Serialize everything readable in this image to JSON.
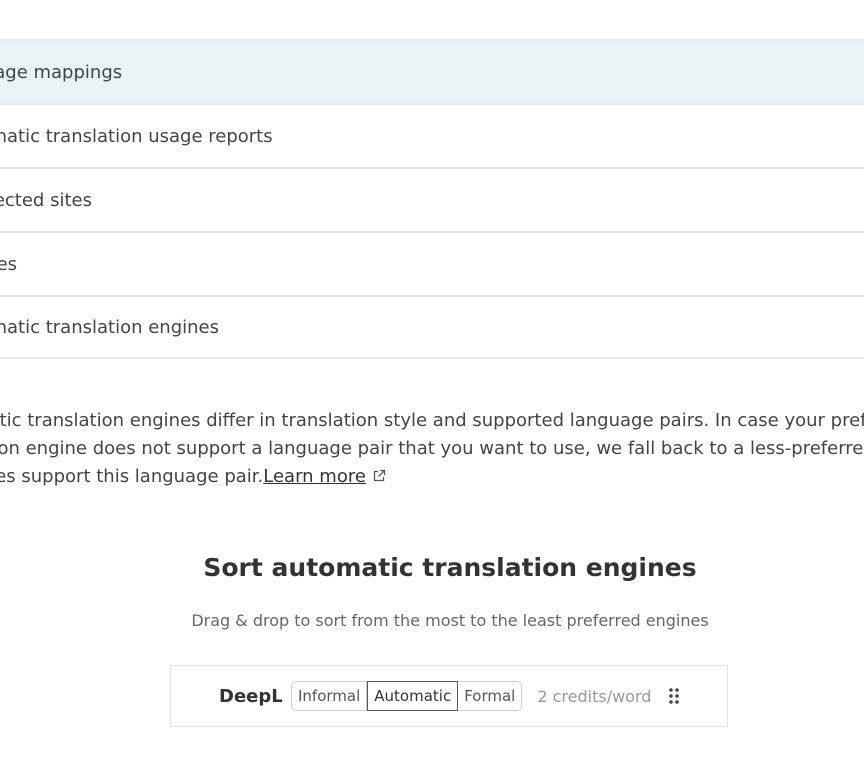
{
  "nav": {
    "items": [
      {
        "label": "Language mappings",
        "shown": "nguage mappings",
        "active": true
      },
      {
        "label": "Automatic translation usage reports",
        "shown": "utomatic translation usage reports",
        "active": false
      },
      {
        "label": "Connected sites",
        "shown": "onnected sites",
        "active": false
      },
      {
        "label": "Invoices",
        "shown": "voices",
        "active": false
      },
      {
        "label": "Automatic translation engines",
        "shown": "utomatic translation engines",
        "active": false
      }
    ]
  },
  "description": {
    "line1": "omatic translation engines differ in translation style and supported language pairs. In case your preferr",
    "line2": "slation engine does not support a language pair that you want to use, we fall back to a less-preferred e",
    "line3": "t does support this language pair.",
    "learn_more": "Learn more"
  },
  "sort": {
    "title": "Sort automatic translation engines",
    "subtitle": "Drag & drop to sort from the most to the least preferred engines"
  },
  "engines": [
    {
      "name": "DeepL",
      "options": [
        "Informal",
        "Automatic",
        "Formal"
      ],
      "selected": "Automatic",
      "credits": "2 credits/word"
    }
  ],
  "colors": {
    "active_row_bg": "#e8f3f5",
    "border": "#e6e6e6"
  },
  "icons": {
    "external_link": "external-link-icon",
    "drag": "drag-handle-icon"
  }
}
